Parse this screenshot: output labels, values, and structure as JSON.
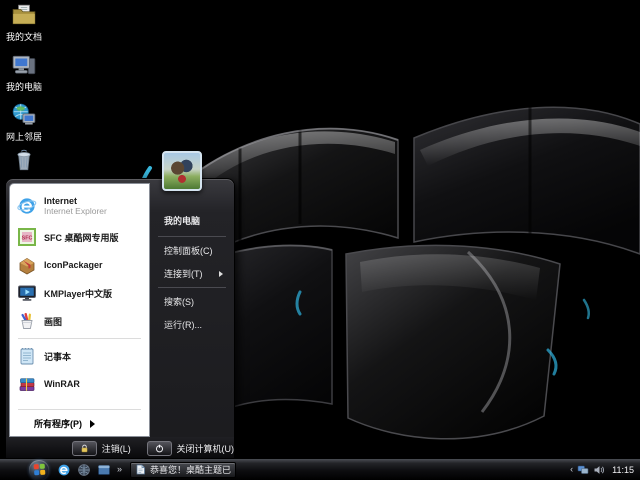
{
  "colors": {
    "accent_cyan": "#3ec9f2",
    "start_menu_dark": "#232327",
    "start_menu_left_bg": "#ffffff",
    "taskbar_bg": "#0d0d10",
    "selection_blue": "#2f71cd"
  },
  "desktop": {
    "icons": [
      {
        "label": "我的文档",
        "icon": "my-documents-icon"
      },
      {
        "label": "我的电脑",
        "icon": "my-computer-icon"
      },
      {
        "label": "网上邻居",
        "icon": "network-places-icon"
      },
      {
        "icon": "recycle-bin-icon"
      }
    ]
  },
  "start_menu": {
    "left_items": [
      {
        "title": "Internet",
        "subtitle": "Internet Explorer",
        "icon": "internet-explorer-icon"
      },
      {
        "title": "SFC 桌酷网专用版",
        "icon": "sfc-zhuoku-icon"
      },
      {
        "title": "IconPackager",
        "icon": "iconpackager-icon"
      },
      {
        "title": "KMPlayer中文版",
        "icon": "kmplayer-icon"
      },
      {
        "title": "画图",
        "icon": "paint-icon"
      },
      {
        "title": "记事本",
        "icon": "notepad-icon"
      },
      {
        "title": "WinRAR",
        "icon": "winrar-icon"
      }
    ],
    "all_programs_label": "所有程序(P)",
    "right_items": [
      {
        "label": "我的电脑"
      },
      {
        "label": "控制面板(C)"
      },
      {
        "label": "连接到(T)"
      },
      {
        "label": "搜索(S)"
      },
      {
        "label": "运行(R)..."
      }
    ],
    "user_avatar": "hands-photo-avatar",
    "logoff_label": "注销(L)",
    "shutdown_label": "关闭计算机(U)"
  },
  "taskbar": {
    "start_button": "windows-orb",
    "quick_launch_icons": [
      "internet-explorer-icon",
      "globe-icon",
      "window-icon"
    ],
    "overflow_chevron": "»",
    "task_button": {
      "label": "恭喜您！桌酷主题已...",
      "icon": "document-icon"
    },
    "tray": {
      "collapse_chevron": "‹",
      "icons": [
        "network-icon",
        "volume-icon"
      ],
      "clock": "11:15"
    }
  }
}
